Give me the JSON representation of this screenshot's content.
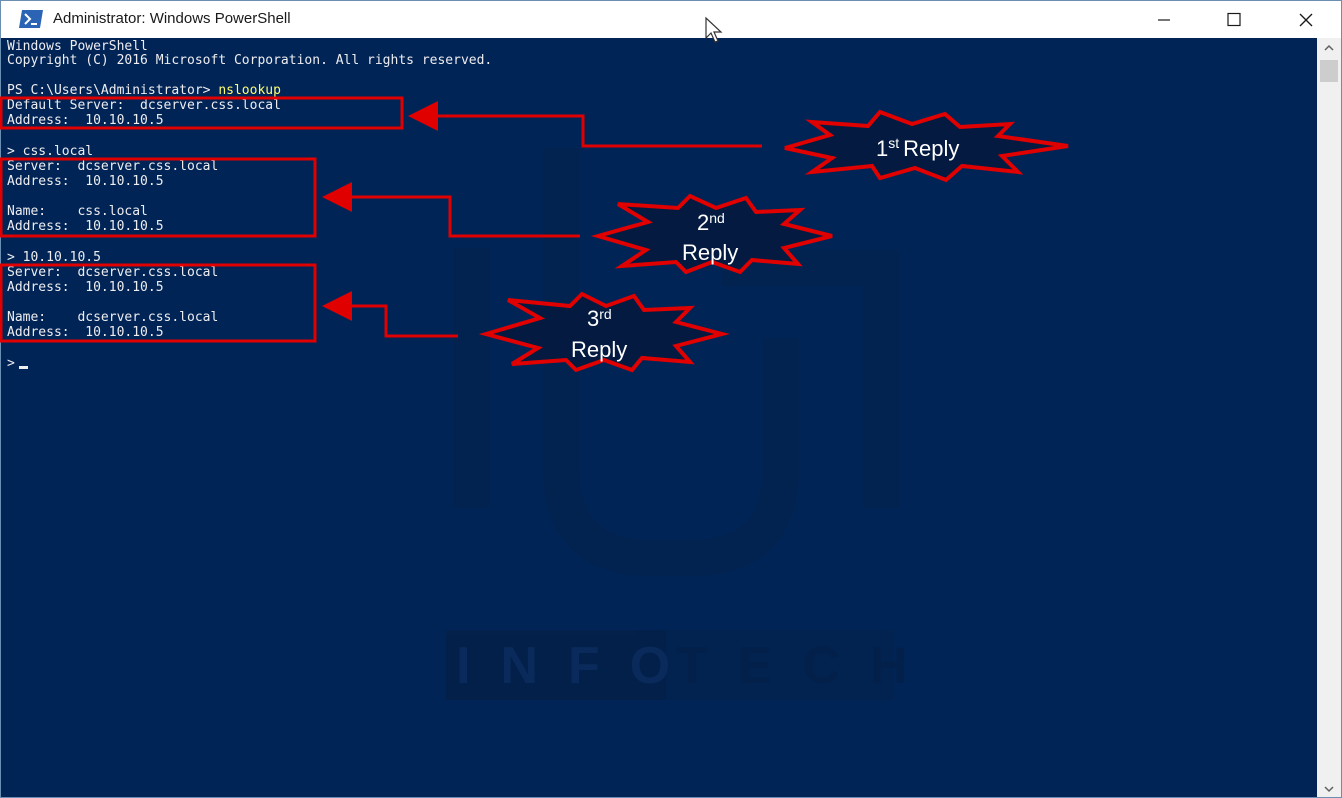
{
  "window": {
    "title": "Administrator: Windows PowerShell",
    "icon": "powershell-icon",
    "controls": [
      "minimize-icon",
      "maximize-icon",
      "close-icon"
    ]
  },
  "console": {
    "header_1": "Windows PowerShell",
    "header_2": "Copyright (C) 2016 Microsoft Corporation. All rights reserved.",
    "prompt": "PS C:\\Users\\Administrator> ",
    "command": "nslookup",
    "default_server_line": "Default Server:  dcserver.css.local",
    "default_address_line": "Address:  10.10.10.5",
    "query_1": "> css.local",
    "q1_server_line": "Server:  dcserver.css.local",
    "q1_address_line": "Address:  10.10.10.5",
    "q1_name_line": "Name:    css.local",
    "q1_name_address_line": "Address:  10.10.10.5",
    "query_2": "> 10.10.10.5",
    "q2_server_line": "Server:  dcserver.css.local",
    "q2_address_line": "Address:  10.10.10.5",
    "q2_name_line": "Name:    dcserver.css.local",
    "q2_name_address_line": "Address:  10.10.10.5",
    "final_prompt": ">"
  },
  "annotations": {
    "reply_1": {
      "ordinal": "1",
      "suffix": "st",
      "word": "Reply"
    },
    "reply_2": {
      "ordinal": "2",
      "suffix": "nd",
      "word": "Reply"
    },
    "reply_3": {
      "ordinal": "3",
      "suffix": "rd",
      "word": "Reply"
    },
    "color": "#e00000"
  },
  "watermark": {
    "text_1": "INFO",
    "text_2": "TECH"
  },
  "colors": {
    "console_bg": "#012456",
    "console_text": "#eeedf0",
    "command_text": "#fdfd72",
    "annotation_red": "#e00000"
  }
}
